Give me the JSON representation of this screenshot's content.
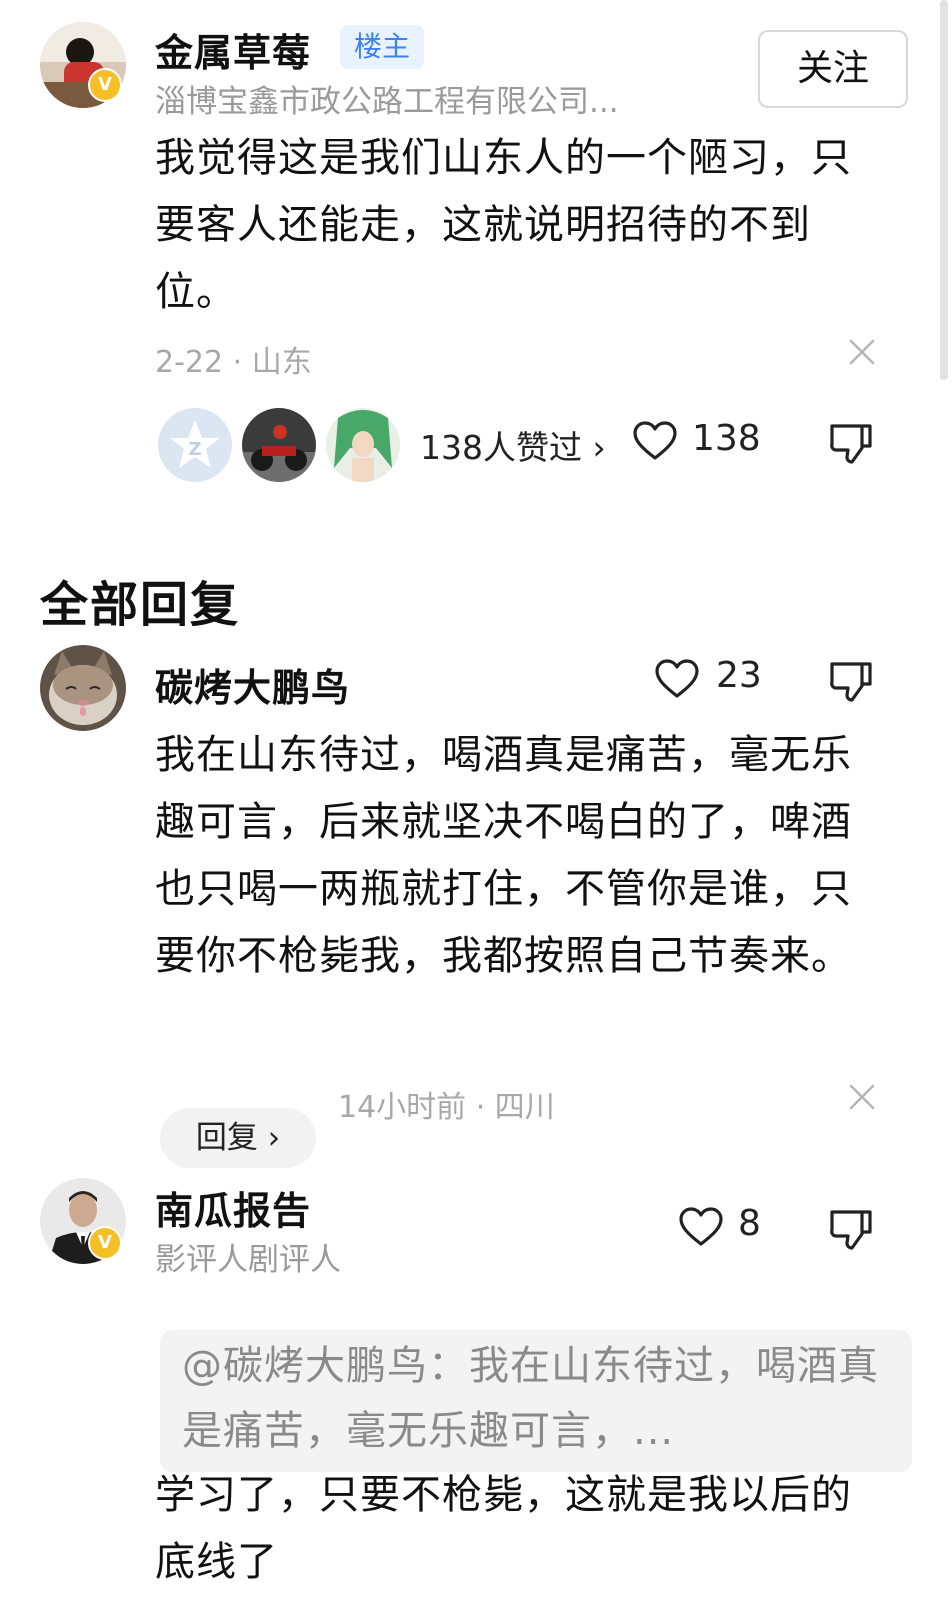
{
  "op": {
    "name": "金属草莓",
    "badge": "楼主",
    "subtitle": "淄博宝鑫市政公路工程有限公司...",
    "follow_label": "关注",
    "text": "我觉得这是我们山东人的一个陋习，只要客人还能走，这就说明招待的不到位。",
    "meta": "2-22 · 山东",
    "likers_label": "138人赞过 ›",
    "like_count": "138",
    "verified_mark": "V"
  },
  "section_title": "全部回复",
  "comments": [
    {
      "name": "碳烤大鹏鸟",
      "like_count": "23",
      "text": "我在山东待过，喝酒真是痛苦，毫无乐趣可言，后来就坚决不喝白的了，啤酒也只喝一两瓶就打住，不管你是谁，只要你不枪毙我，我都按照自己节奏来。",
      "reply_label": "回复 ›",
      "meta": "14小时前 · 四川"
    },
    {
      "name": "南瓜报告",
      "subtitle": "影评人剧评人",
      "like_count": "8",
      "quote": "@碳烤大鹏鸟：我在山东待过，喝酒真是痛苦，毫无乐趣可言，...",
      "text": "学习了，只要不枪毙，这就是我以后的底线了",
      "verified_mark": "V"
    }
  ],
  "colors": {
    "badge_bg": "#e9f2ff",
    "badge_text": "#3b82f6",
    "verified": "#f5c026",
    "muted": "#a8a8a8"
  }
}
